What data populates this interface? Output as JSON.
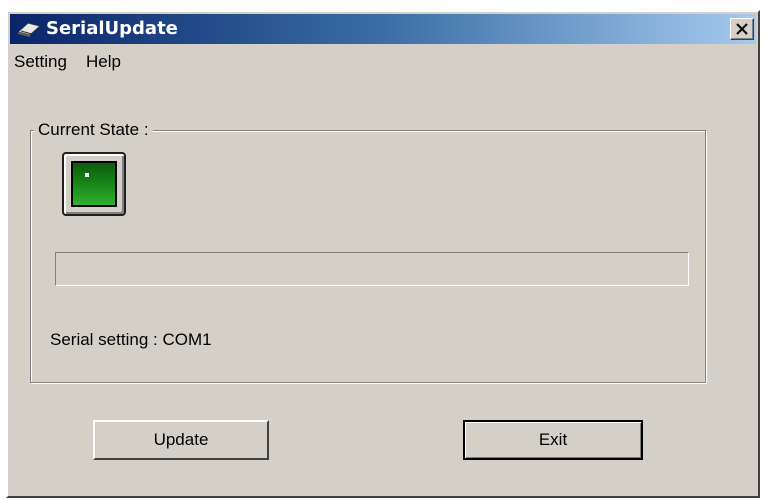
{
  "window": {
    "title": "SerialUpdate",
    "icon": "plug-icon",
    "close_glyph": "close-icon"
  },
  "menu": {
    "items": [
      {
        "label": "Setting"
      },
      {
        "label": "Help"
      }
    ]
  },
  "state_group": {
    "label": "Current State :",
    "indicator": "green-status-light",
    "indicator_color": "#1a8a1a",
    "progress_fraction": 0
  },
  "serial": {
    "text": "Serial setting : COM1"
  },
  "buttons": {
    "update_label": "Update",
    "exit_label": "Exit"
  },
  "colors": {
    "titlebar_start": "#0a246a",
    "titlebar_end": "#a6caf0",
    "face": "#d4d0c8"
  }
}
